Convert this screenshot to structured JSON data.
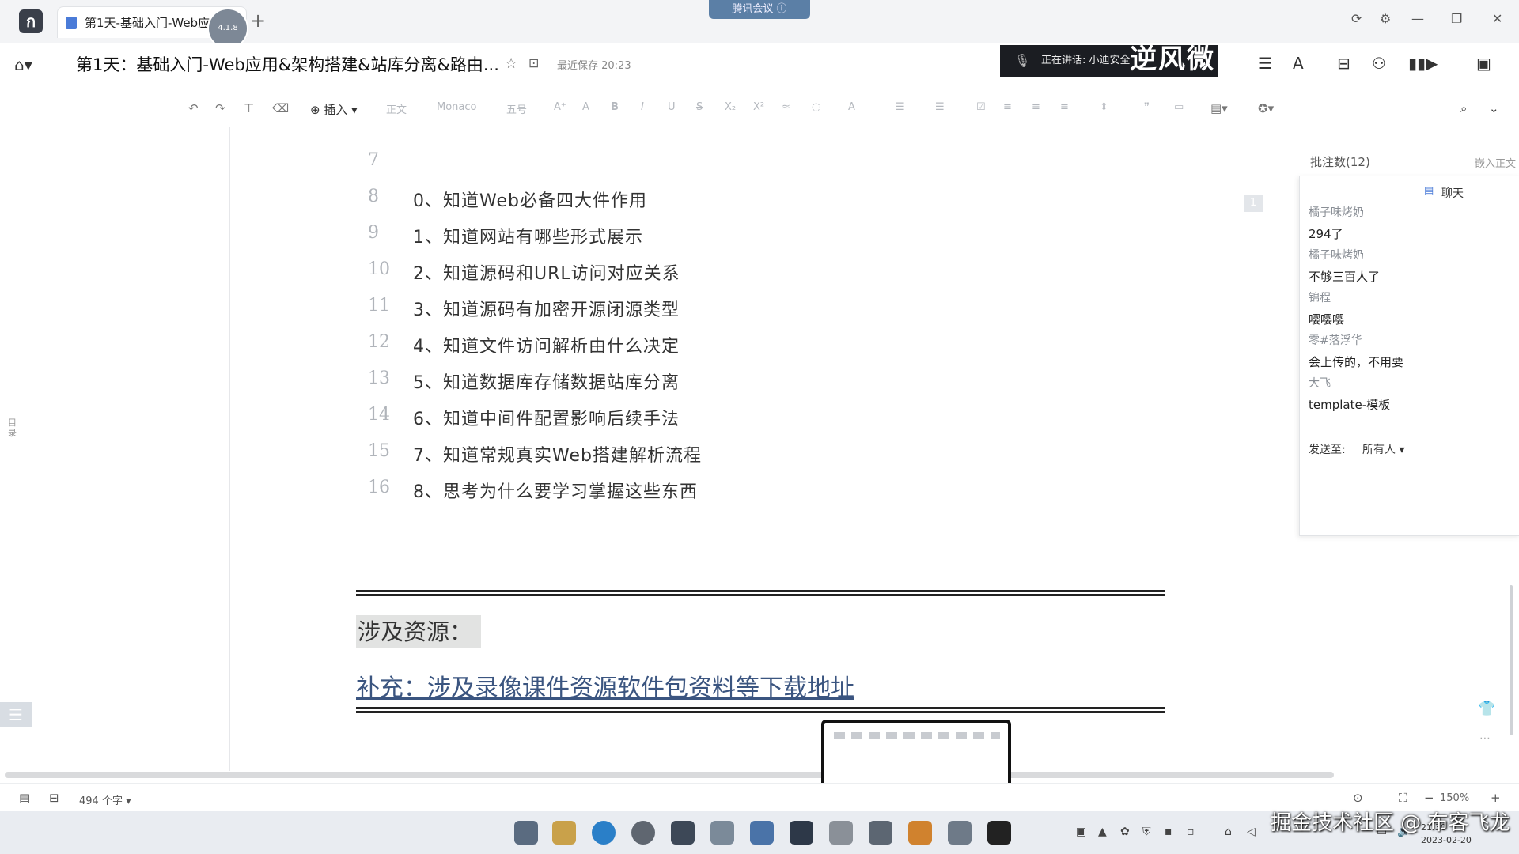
{
  "titlebar": {
    "tab_label": "第1天-基础入门-Web应",
    "avatar_label": "4.1.8",
    "meeting_banner": "腾讯会议 ⓘ"
  },
  "header": {
    "doc_title": "第1天：基础入门-Web应用&架构搭建&站库分离&路由...",
    "save_status": "最近保存 20:23",
    "speaker_text": "正在讲话: 小迪安全",
    "speaker_overlay": "逆风微"
  },
  "toolbar": {
    "insert_label": "插入",
    "style_label": "正文",
    "font_label": "Monaco",
    "size_label": "五号"
  },
  "sidebar": {
    "toc_label": "目录"
  },
  "document": {
    "line_7": "7",
    "lines": [
      {
        "num": "8",
        "text": "0、知道Web必备四大件作用"
      },
      {
        "num": "9",
        "text": "1、知道网站有哪些形式展示"
      },
      {
        "num": "10",
        "text": "2、知道源码和URL访问对应关系"
      },
      {
        "num": "11",
        "text": "3、知道源码有加密开源闭源类型"
      },
      {
        "num": "12",
        "text": "4、知道文件访问解析由什么决定"
      },
      {
        "num": "13",
        "text": "5、知道数据库存储数据站库分离"
      },
      {
        "num": "14",
        "text": "6、知道中间件配置影响后续手法"
      },
      {
        "num": "15",
        "text": "7、知道常规真实Web搭建解析流程"
      },
      {
        "num": "16",
        "text": "8、思考为什么要学习掌握这些东西"
      }
    ],
    "comment_marker": "1",
    "resource_heading": "涉及资源：",
    "supplement_link": "补充：涉及录像课件资源软件包资料等下载地址"
  },
  "comments": {
    "count_label": "批注数(12)",
    "right_label": "嵌入正文"
  },
  "chat": {
    "title": "聊天",
    "messages": [
      {
        "name": "橘子味烤奶",
        "text": "294了"
      },
      {
        "name": "橘子味烤奶",
        "text": "不够三百人了"
      },
      {
        "name": "锦程",
        "text": "嘤嘤嘤"
      },
      {
        "name": "零#落浮华",
        "text": "会上传的，不用要"
      },
      {
        "name": "大飞",
        "text": "template-模板"
      }
    ],
    "send_to_label": "发送至:",
    "send_to_value": "所有人 ▾"
  },
  "statusbar": {
    "word_count": "494 个字 ▾",
    "zoom": "150%"
  },
  "taskbar": {
    "time": "21:30",
    "date": "2023-02-20",
    "watermark": "掘金技术社区 @ 布客飞龙"
  },
  "colors": {
    "link": "#3b5580",
    "heading_bg": "#e2e3e2",
    "taskbar_bg": "#e9ecf1"
  }
}
